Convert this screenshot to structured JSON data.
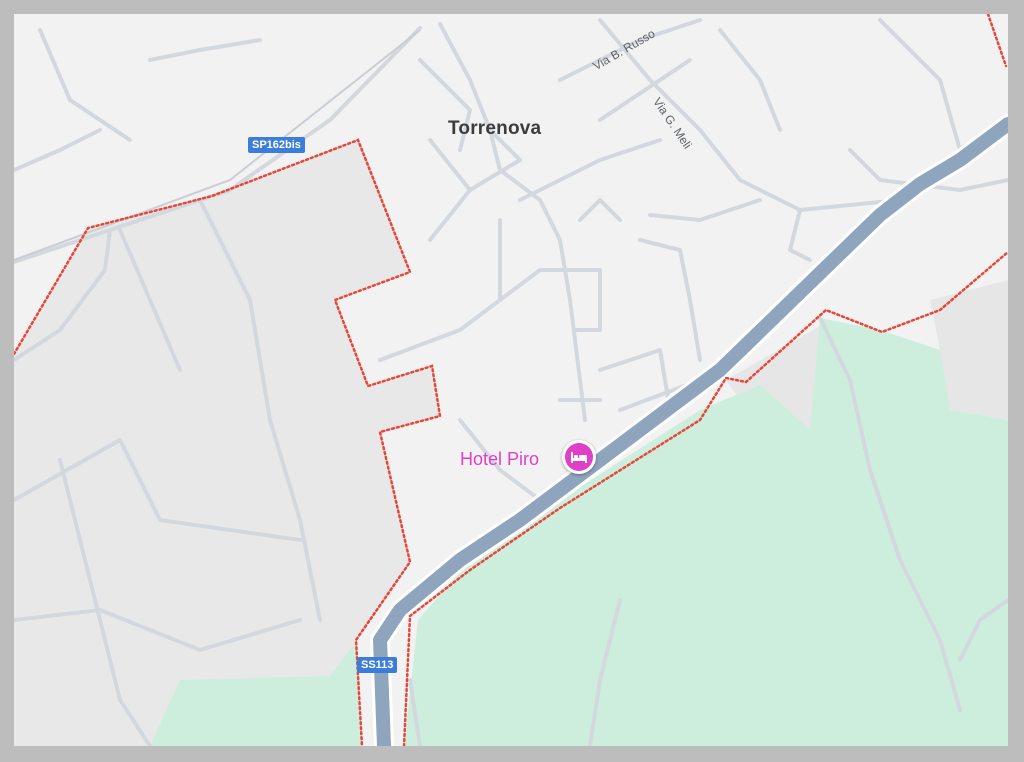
{
  "map": {
    "place_label": "Torrenova",
    "streets": {
      "via_russo": "Via B. Russo",
      "via_meli": "Via G. Meli"
    },
    "road_shields": {
      "sp162bis": "SP162bis",
      "ss113": "SS113"
    },
    "poi": {
      "name": "Hotel Piro",
      "icon": "hotel-bed-icon"
    },
    "colors": {
      "background": "#f2f2f3",
      "park": "#cdeedd",
      "urban_area": "#e8e8e9",
      "road_minor": "#d3d8de",
      "highway": "#8fa4bd",
      "boundary": "#e5483a",
      "poi_accent": "#e040c8",
      "shield": "#3b7dd8"
    }
  }
}
